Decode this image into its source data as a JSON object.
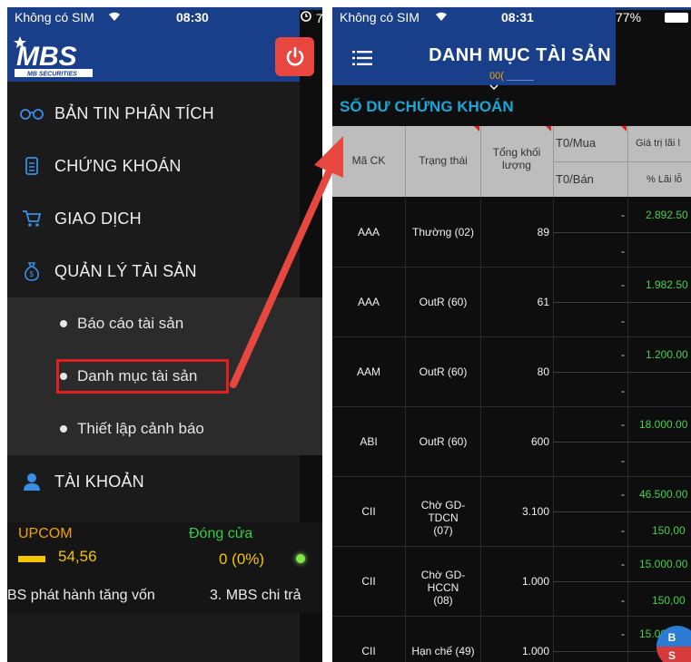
{
  "left_status": {
    "carrier": "Không có SIM",
    "time": "08:30",
    "right": "7"
  },
  "logo_text": "MBS",
  "logo_sub": "MB SECURITIES",
  "menu": [
    {
      "label": "BẢN TIN PHÂN TÍCH",
      "icon": "glasses-icon"
    },
    {
      "label": "CHỨNG KHOÁN",
      "icon": "document-icon"
    },
    {
      "label": "GIAO DỊCH",
      "icon": "cart-icon"
    },
    {
      "label": "QUẢN LÝ TÀI SẢN",
      "icon": "money-bag-icon"
    }
  ],
  "submenu": [
    {
      "label": "Báo cáo tài sản"
    },
    {
      "label": "Danh mục tài sản"
    },
    {
      "label": "Thiết lập cảnh báo"
    }
  ],
  "account_menu": {
    "label": "TÀI KHOẢN",
    "icon": "user-icon"
  },
  "market": {
    "name": "UPCOM",
    "status": "Đóng cửa",
    "index": "54,56",
    "change": "0 (0%)"
  },
  "ticker": {
    "item1": "BS phát hành tăng vốn",
    "item2": "3. MBS chi trả"
  },
  "right_status": {
    "carrier": "Không có SIM",
    "time": "08:31",
    "battery": "77%"
  },
  "screen_title": "DANH MỤC TÀI SẢN",
  "account_no": "00(",
  "section_title": "SỐ DƯ CHỨNG KHOÁN",
  "table_headers": {
    "code": "Mã CK",
    "status": "Trạng thái",
    "volume": "Tổng khối lượng",
    "t0_buy": "T0/Mua",
    "t0_sell": "T0/Bán",
    "pnl_value": "Giá trị lãi l",
    "pnl_pct": "% Lãi lỗ"
  },
  "rows": [
    {
      "code": "AAA",
      "status": "Thường (02)",
      "volume": "89",
      "t0_buy": "-",
      "t0_sell": "-",
      "pnl": "2.892.50",
      "pct": ""
    },
    {
      "code": "AAA",
      "status": "OutR (60)",
      "volume": "61",
      "t0_buy": "-",
      "t0_sell": "-",
      "pnl": "1.982.50",
      "pct": ""
    },
    {
      "code": "AAM",
      "status": "OutR (60)",
      "volume": "80",
      "t0_buy": "-",
      "t0_sell": "-",
      "pnl": "1.200.00",
      "pct": ""
    },
    {
      "code": "ABI",
      "status": "OutR (60)",
      "volume": "600",
      "t0_buy": "-",
      "t0_sell": "-",
      "pnl": "18.000.00",
      "pct": ""
    },
    {
      "code": "CII",
      "status": "Chờ GD-TDCN (07)",
      "volume": "3.100",
      "t0_buy": "-",
      "t0_sell": "-",
      "pnl": "46.500.00",
      "pct": "150,00"
    },
    {
      "code": "CII",
      "status": "Chờ GD-HCCN (08)",
      "volume": "1.000",
      "t0_buy": "-",
      "t0_sell": "-",
      "pnl": "15.000.00",
      "pct": "150,00"
    },
    {
      "code": "CII",
      "status": "Hạn chế (49)",
      "volume": "1.000",
      "t0_buy": "-",
      "t0_sell": "",
      "pnl": "15.000.00",
      "pct": ""
    }
  ],
  "fab": {
    "top": "B",
    "bottom": "S"
  },
  "colors": {
    "header_blue": "#1a3f8a",
    "accent_red": "#e8473f",
    "gain_green": "#45d24d",
    "section_blue": "#1aa6d6",
    "upcom_orange": "#f4a000"
  }
}
